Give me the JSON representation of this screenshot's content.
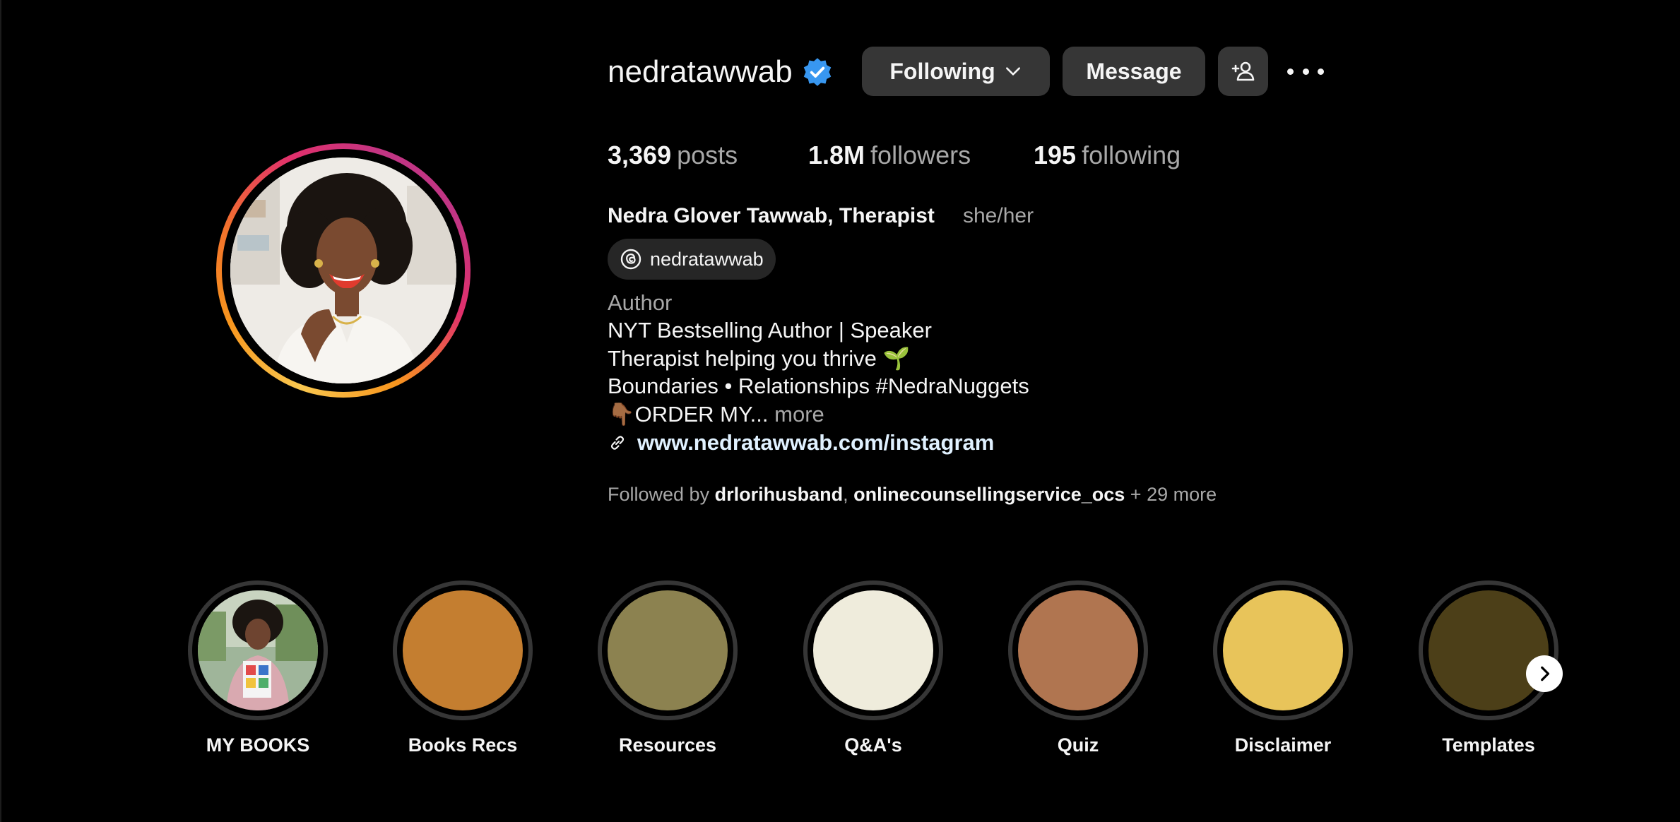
{
  "profile": {
    "username": "nedratawwab",
    "verified_icon": "verified-badge-icon",
    "avatar_icon": "profile-photo",
    "buttons": {
      "following": "Following",
      "message": "Message",
      "add_user_icon": "add-user-icon",
      "more_icon": "more-options-icon"
    },
    "stats": {
      "posts_count": "3,369",
      "posts_label": "posts",
      "followers_count": "1.8M",
      "followers_label": "followers",
      "following_count": "195",
      "following_label": "following"
    },
    "full_name": "Nedra Glover Tawwab, Therapist",
    "pronouns": "she/her",
    "threads_handle": "nedratawwab",
    "bio": {
      "category": "Author",
      "line1": "NYT Bestselling Author | Speaker",
      "line2": "Therapist helping you thrive 🌱",
      "line3": "Boundaries • Relationships #NedraNuggets",
      "line4": "👇🏾ORDER MY...",
      "more": "more"
    },
    "link": "www.nedratawwab.com/instagram",
    "followed_by": {
      "prefix": "Followed by",
      "account1": "drlorihusband",
      "separator": ",",
      "account2": "onlinecounsellingservice_ocs",
      "suffix": "+ 29 more"
    }
  },
  "highlights": [
    {
      "label": "MY BOOKS",
      "color": "#a8b8a0"
    },
    {
      "label": "Books Recs",
      "color": "#c47e30"
    },
    {
      "label": "Resources",
      "color": "#8c8250"
    },
    {
      "label": "Q&A's",
      "color": "#efecdc"
    },
    {
      "label": "Quiz",
      "color": "#b07550"
    },
    {
      "label": "Disclaimer",
      "color": "#e8c45a"
    },
    {
      "label": "Templates",
      "color": "#4c3f18"
    }
  ],
  "colors": {
    "background": "#000000",
    "button_bg": "#363636",
    "verified_blue": "#3897f0",
    "secondary_text": "#a8a8a8",
    "link_text": "#e0f1ff"
  }
}
